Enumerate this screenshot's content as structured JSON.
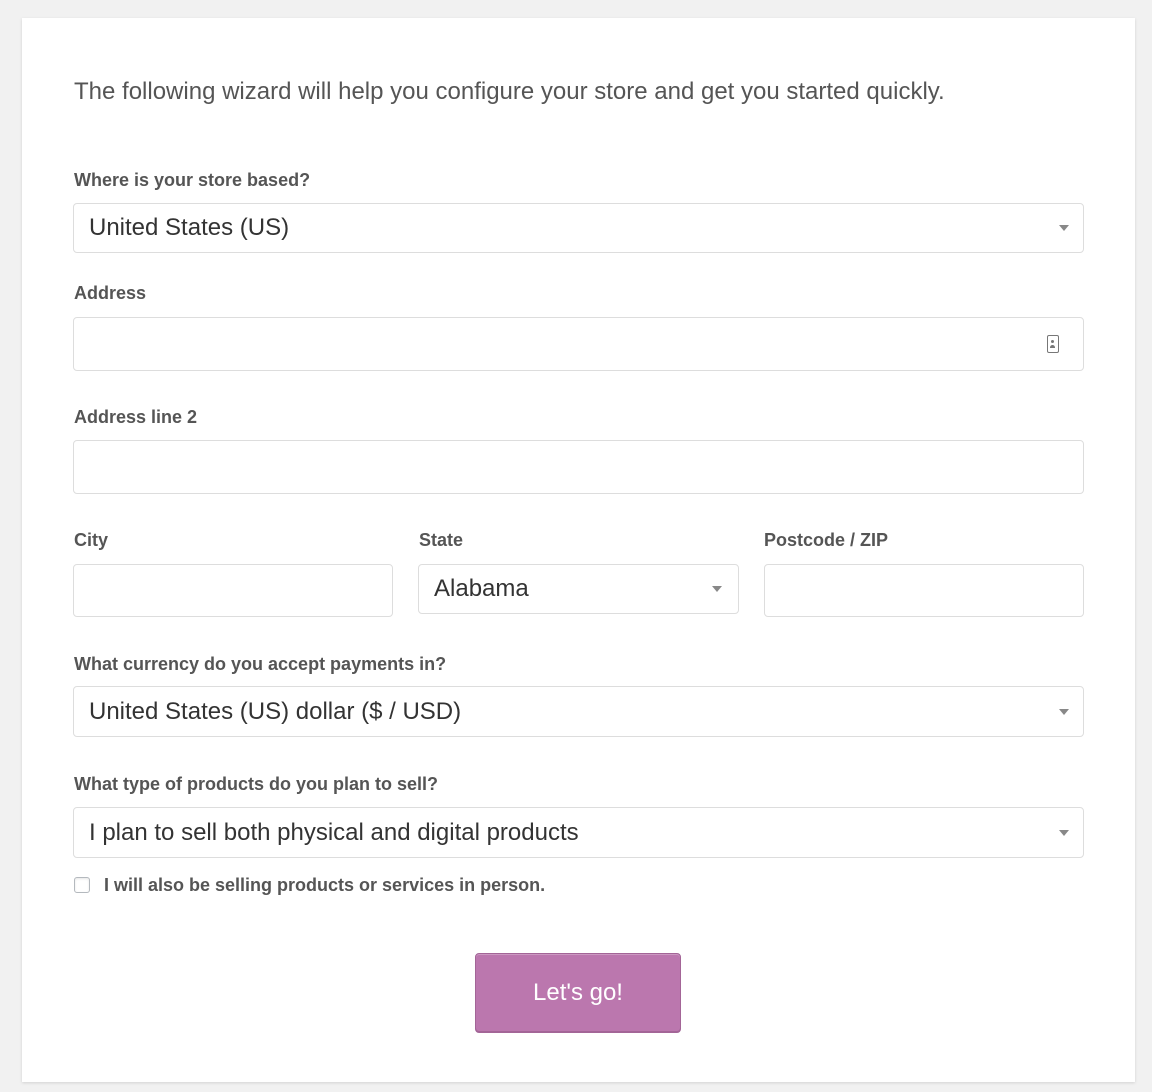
{
  "intro_text": "The following wizard will help you configure your store and get you started quickly.",
  "store_location": {
    "label": "Where is your store based?",
    "value": "United States (US)"
  },
  "address": {
    "label": "Address",
    "value": "",
    "icon": "contact-card-icon"
  },
  "address_2": {
    "label": "Address line 2",
    "value": ""
  },
  "city": {
    "label": "City",
    "value": ""
  },
  "state": {
    "label": "State",
    "value": "Alabama"
  },
  "postcode": {
    "label": "Postcode / ZIP",
    "value": ""
  },
  "currency": {
    "label": "What currency do you accept payments in?",
    "value": "United States (US) dollar ($ / USD)"
  },
  "product_type": {
    "label": "What type of products do you plan to sell?",
    "value": "I plan to sell both physical and digital products"
  },
  "in_person": {
    "label": "I will also be selling products or services in person.",
    "checked": false
  },
  "submit_label": "Let's go!",
  "colors": {
    "background": "#f1f1f1",
    "card": "#ffffff",
    "text": "#555555",
    "primary_button": "#bb77ae",
    "border": "#dddddd"
  }
}
